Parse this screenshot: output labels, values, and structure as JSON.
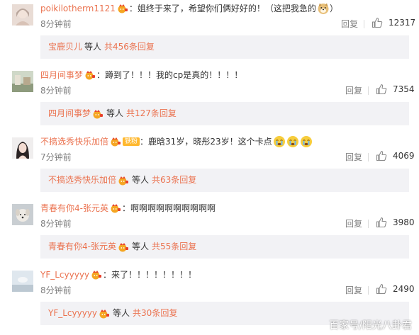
{
  "colors": {
    "accent": "#eb7350",
    "text": "#333333",
    "muted": "#808080",
    "reply_bg": "#f2f2f5"
  },
  "comments": [
    {
      "username": "poikilotherm1121",
      "separator": "：",
      "text": "姐终于来了，希望你们俩好好的！（这把我急的",
      "text_end": "）",
      "time": "8分钟前",
      "reply_label": "回复",
      "likes": "12317",
      "reply_preview": {
        "name": "宝鹿贝儿",
        "middle": "等人",
        "total": "共456条回复"
      },
      "avatar": "avatar-girl-photo"
    },
    {
      "username": "四月间事梦",
      "separator": "：",
      "text": "蹲到了！！！我的cp是真的！！！！",
      "time": "8分钟前",
      "reply_label": "回复",
      "likes": "7354",
      "reply_preview": {
        "name": "四月间事梦",
        "middle": "等人",
        "total": "共127条回复"
      },
      "avatar": "avatar-scene-photo"
    },
    {
      "username": "不搞选秀快乐加倍",
      "fan_badge": "铁粉",
      "separator": "：",
      "text": "鹿晗31岁，晓彤23岁！这个卡点",
      "time": "7分钟前",
      "reply_label": "回复",
      "likes": "4069",
      "reply_preview": {
        "name": "不搞选秀快乐加倍",
        "middle": "等人",
        "total": "共63条回复"
      },
      "avatar": "avatar-portrait-photo"
    },
    {
      "username": "青春有你4-张元英",
      "separator": "：",
      "text": "啊啊啊啊啊啊啊啊啊啊",
      "time": "8分钟前",
      "reply_label": "回复",
      "likes": "3980",
      "reply_preview": {
        "name": "青春有你4-张元英",
        "middle": "等人",
        "total": "共55条回复"
      },
      "avatar": "avatar-dog-photo"
    },
    {
      "username": "YF_Lcyyyyy",
      "separator": "：",
      "text": "来了！！！！！！！！",
      "time": "8分钟前",
      "reply_label": "回复",
      "likes": "2490",
      "reply_preview": {
        "name": "YF_Lcyyyyy",
        "middle": "等人",
        "total": "共30条回复"
      },
      "avatar": "avatar-sky-photo"
    }
  ],
  "watermark": "百家号/阳光八卦君"
}
